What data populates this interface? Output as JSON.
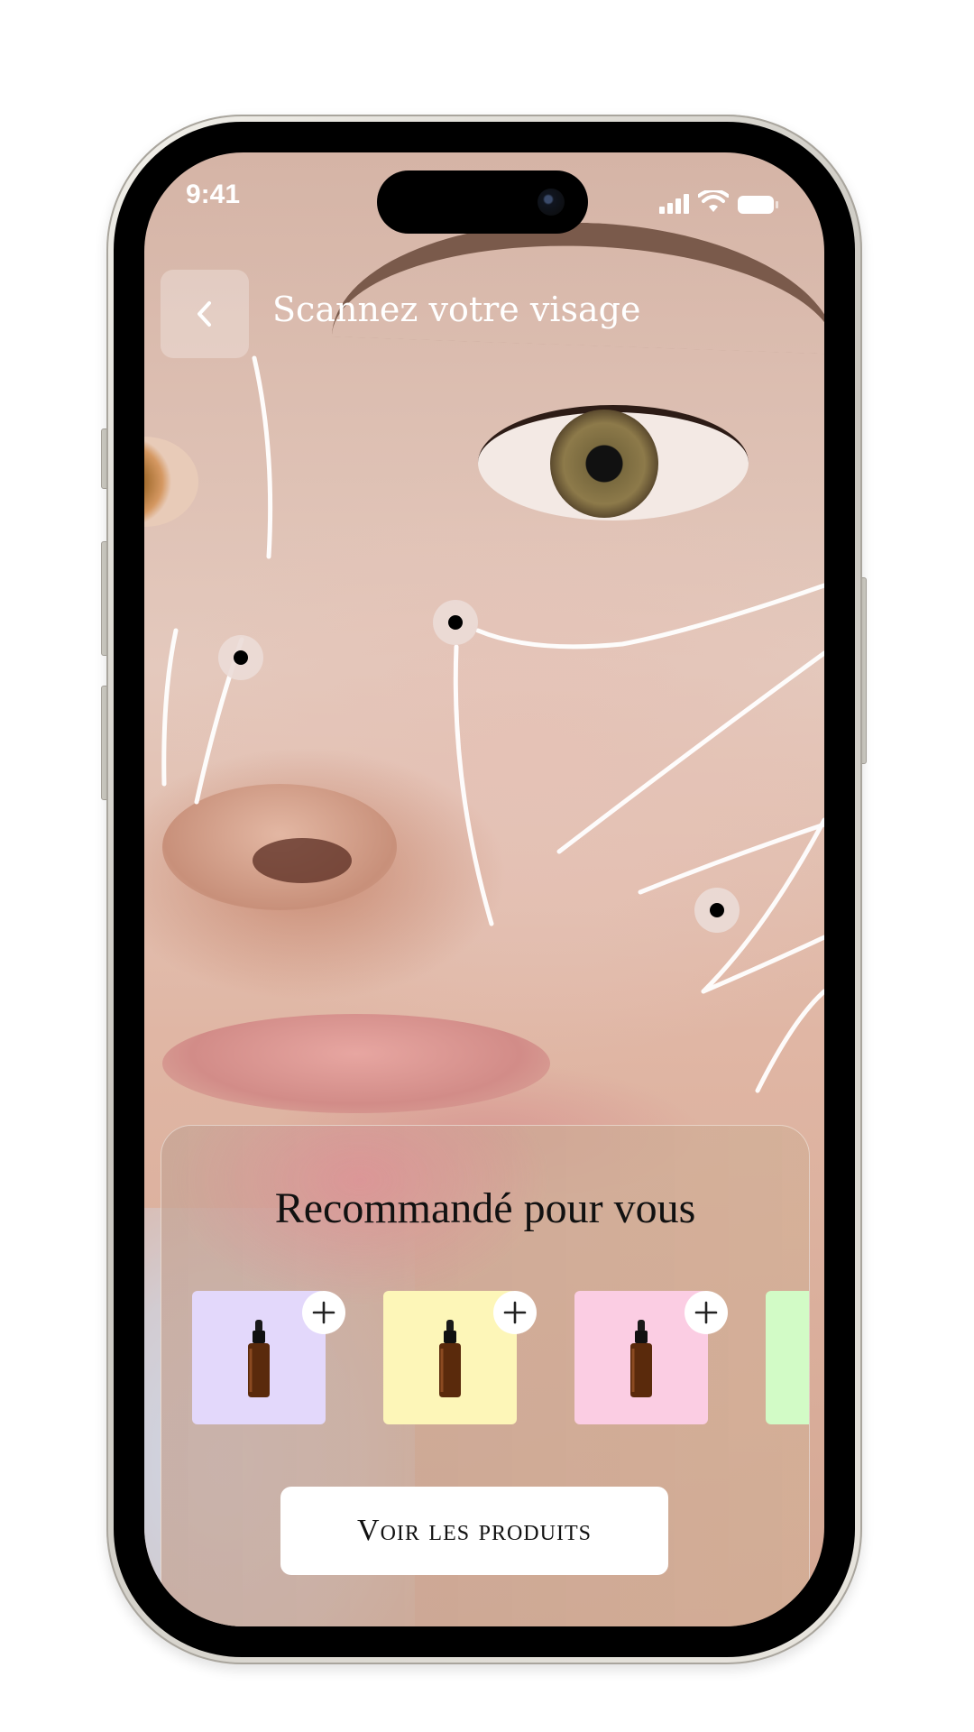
{
  "status_bar": {
    "time": "9:41"
  },
  "header": {
    "title": "Scannez votre visage",
    "back_icon": "chevron-left-icon"
  },
  "recommendations": {
    "title": "Recommandé pour vous",
    "products": [
      {
        "color": "#e3d8fb",
        "icon": "serum-bottle-icon",
        "add_icon": "plus-icon"
      },
      {
        "color": "#fdf6b8",
        "icon": "serum-bottle-icon",
        "add_icon": "plus-icon"
      },
      {
        "color": "#fbcde3",
        "icon": "serum-bottle-icon",
        "add_icon": "plus-icon"
      },
      {
        "color": "#d2fbc6",
        "icon": "serum-bottle-icon",
        "add_icon": "plus-icon"
      }
    ],
    "cta_label": "Voir les produits"
  }
}
